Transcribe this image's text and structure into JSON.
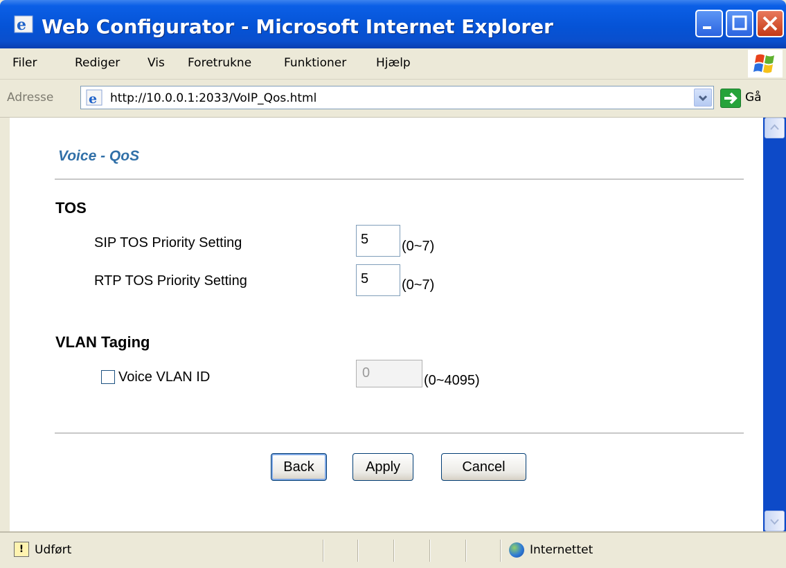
{
  "window": {
    "title": "Web Configurator - Microsoft Internet Explorer"
  },
  "menu": [
    "Filer",
    "Rediger",
    "Vis",
    "Foretrukne",
    "Funktioner",
    "Hjælp"
  ],
  "address_bar": {
    "label": "Adresse",
    "url": "http://10.0.0.1:2033/VoIP_Qos.html",
    "go_label": "Gå"
  },
  "page": {
    "title": "Voice - QoS",
    "tos": {
      "heading": "TOS",
      "sip_label": "SIP TOS Priority Setting",
      "sip_value": "5",
      "sip_range": "(0~7)",
      "rtp_label": "RTP TOS Priority Setting",
      "rtp_value": "5",
      "rtp_range": "(0~7)"
    },
    "vlan": {
      "heading": "VLAN Taging",
      "checkbox_label": "Voice VLAN ID",
      "checked": false,
      "value": "0",
      "range": "(0~4095)"
    },
    "buttons": {
      "back": "Back",
      "apply": "Apply",
      "cancel": "Cancel"
    }
  },
  "status_bar": {
    "status": "Udført",
    "zone": "Internettet"
  }
}
